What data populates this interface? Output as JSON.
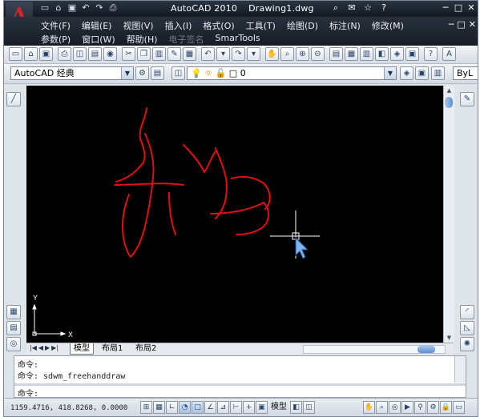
{
  "app": {
    "logo_letter": "A",
    "title": "AutoCAD 2010",
    "document": "Drawing1.dwg",
    "quick_access": [
      "new-icon",
      "open-icon",
      "save-icon",
      "undo-icon",
      "redo-icon",
      "plot-icon"
    ],
    "window_controls": [
      "─",
      "□",
      "✕"
    ]
  },
  "menu": {
    "row1": [
      "文件(F)",
      "编辑(E)",
      "视图(V)",
      "插入(I)",
      "格式(O)",
      "工具(T)",
      "绘图(D)",
      "标注(N)",
      "修改(M)"
    ],
    "row2": [
      "参数(P)",
      "窗口(W)",
      "帮助(H)",
      "电子签名",
      "SmarTools"
    ],
    "row2_dim_index": 3
  },
  "toolbar": {
    "workspace": "AutoCAD 经典",
    "layer": "0",
    "bylayer": "ByL"
  },
  "canvas": {
    "background": "#000000",
    "stroke_color": "#e01010",
    "crosshair_color": "#ffffff",
    "ucs_x": "X",
    "ucs_y": "Y"
  },
  "tabs": {
    "items": [
      "模型",
      "布局1",
      "布局2"
    ],
    "active": 0
  },
  "command": {
    "line1": "命令: ",
    "line2": "命令: sdwm_freehanddraw",
    "prompt": "命令:"
  },
  "status": {
    "coordinates": "1159.4716, 418.8268, 0.0000",
    "model_label": "模型"
  }
}
